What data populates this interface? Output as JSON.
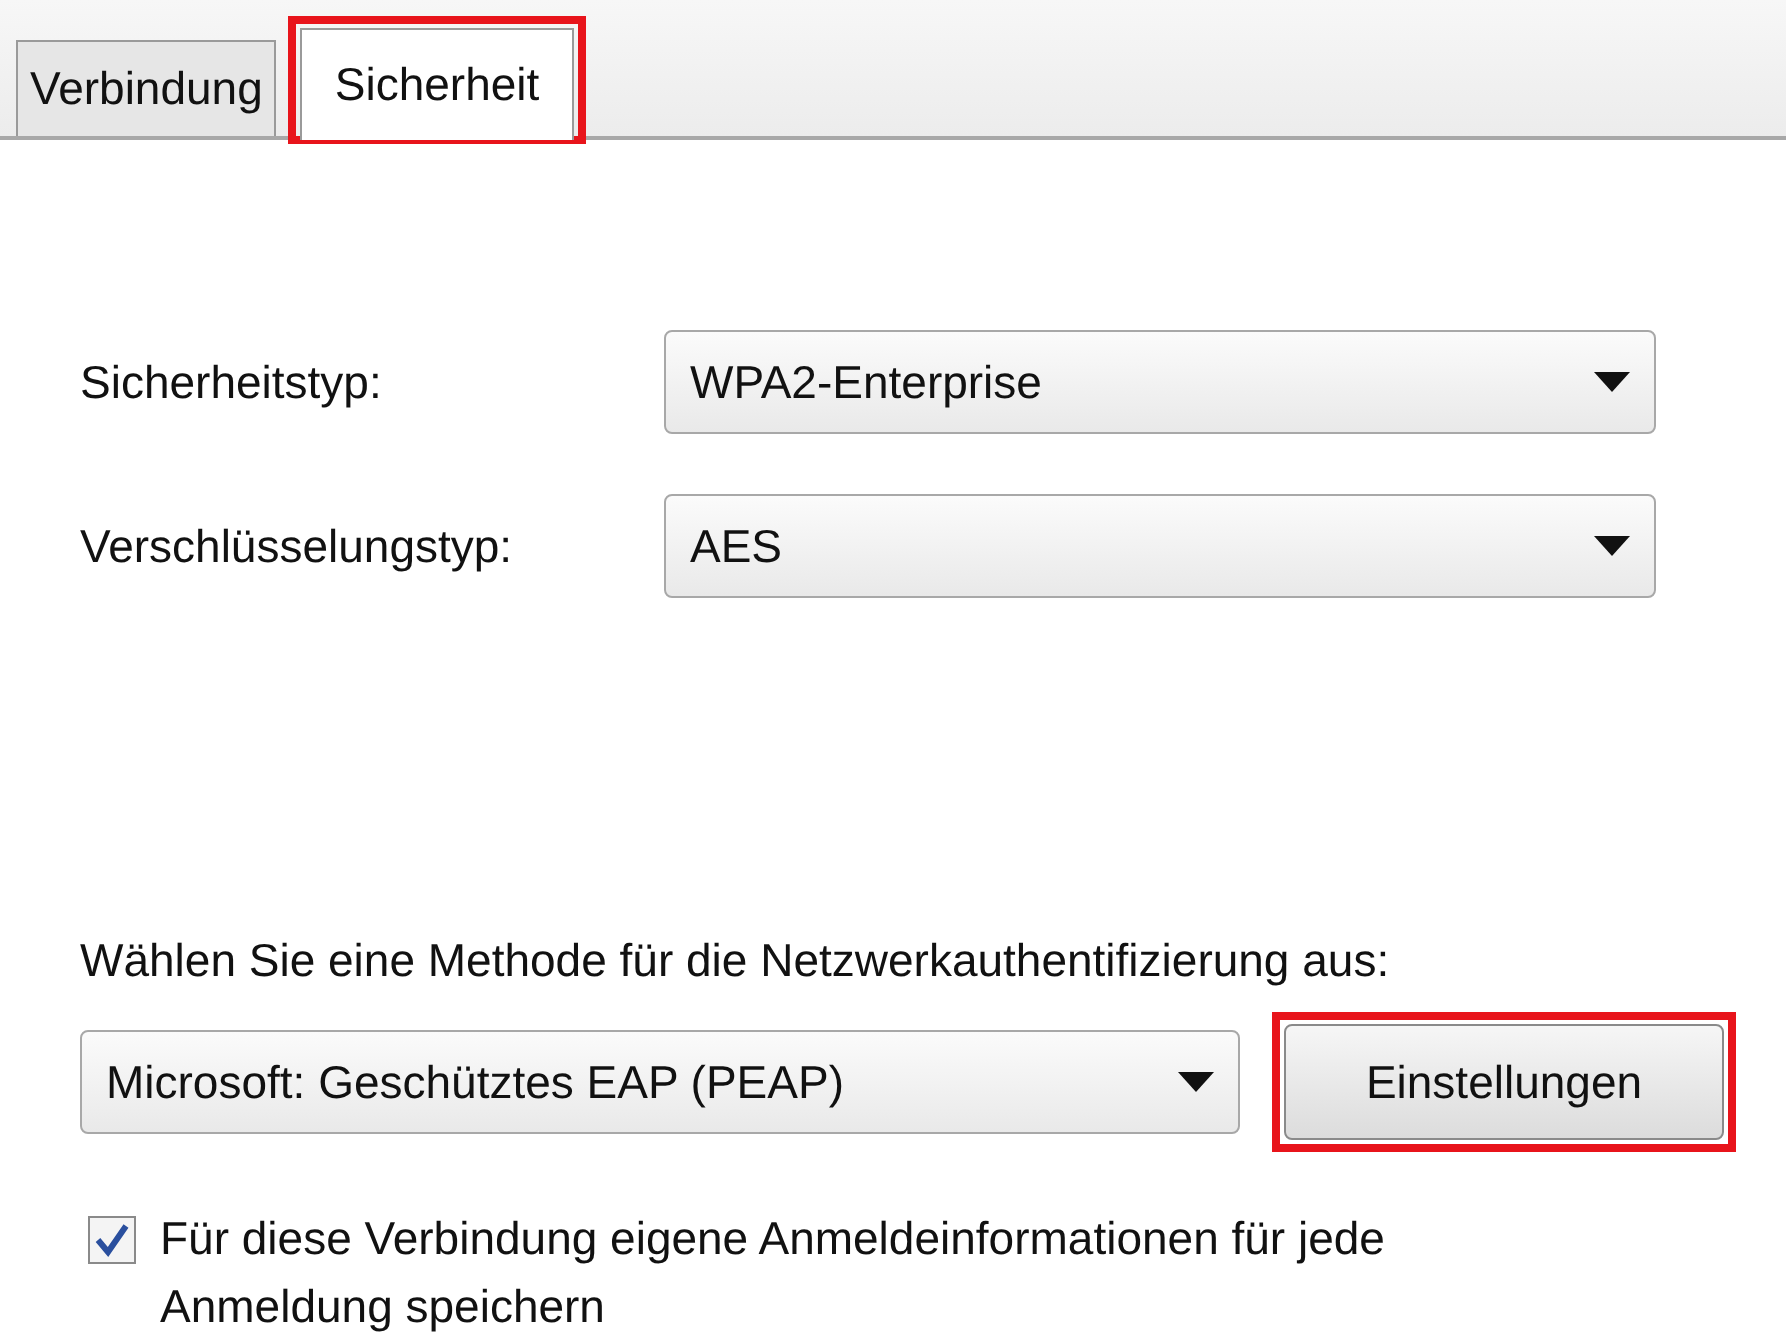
{
  "tabs": [
    {
      "label": "Verbindung",
      "selected": false,
      "highlighted": false
    },
    {
      "label": "Sicherheit",
      "selected": true,
      "highlighted": true
    }
  ],
  "fields": [
    {
      "label": "Sicherheitstyp:",
      "value": "WPA2-Enterprise"
    },
    {
      "label": "Verschlüsselungstyp:",
      "value": "AES"
    }
  ],
  "auth": {
    "prompt": "Wählen Sie eine Methode für die Netzwerkauthentifizierung aus:",
    "method": "Microsoft: Geschütztes EAP (PEAP)",
    "button": {
      "label": "Einstellungen",
      "highlighted": true
    }
  },
  "remember": {
    "label": "Für diese Verbindung eigene Anmeldeinformationen für jede Anmeldung speichern",
    "checked": true
  }
}
